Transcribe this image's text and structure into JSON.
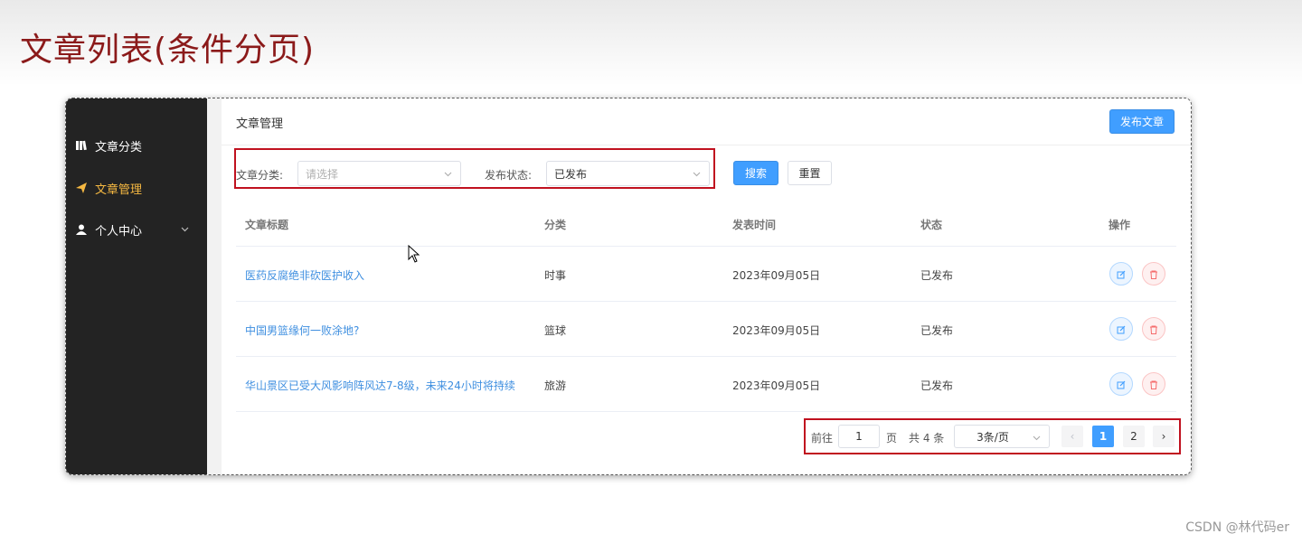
{
  "slide": {
    "title": "文章列表(条件分页)"
  },
  "sidebar": {
    "items": [
      {
        "label": "文章分类",
        "icon": "book-icon",
        "active": false
      },
      {
        "label": "文章管理",
        "icon": "send-icon",
        "active": true
      },
      {
        "label": "个人中心",
        "icon": "user-icon",
        "active": false,
        "has_submenu": true
      }
    ]
  },
  "header": {
    "title": "文章管理",
    "publish_button": "发布文章"
  },
  "filter": {
    "category_label": "文章分类:",
    "category_placeholder": "请选择",
    "status_label": "发布状态:",
    "status_value": "已发布",
    "search_button": "搜索",
    "reset_button": "重置"
  },
  "table": {
    "columns": [
      "文章标题",
      "分类",
      "发表时间",
      "状态",
      "操作"
    ],
    "rows": [
      {
        "title": "医药反腐绝非砍医护收入",
        "category": "时事",
        "date": "2023年09月05日",
        "status": "已发布"
      },
      {
        "title": "中国男篮缘何一败涂地?",
        "category": "篮球",
        "date": "2023年09月05日",
        "status": "已发布"
      },
      {
        "title": "华山景区已受大风影响阵风达7-8级，未来24小时将持续",
        "category": "旅游",
        "date": "2023年09月05日",
        "status": "已发布"
      }
    ]
  },
  "pagination": {
    "goto_prefix": "前往",
    "goto_value": "1",
    "goto_suffix": "页",
    "total_text": "共 4 条",
    "page_size": "3条/页",
    "prev": "‹",
    "pages": [
      "1",
      "2"
    ],
    "current_page": "1",
    "next": "›"
  },
  "colors": {
    "primary": "#409eff",
    "highlight_box": "#c0111f",
    "active_menu": "#f5b842",
    "sidebar_bg": "#232323"
  },
  "watermark": "CSDN @林代码er"
}
